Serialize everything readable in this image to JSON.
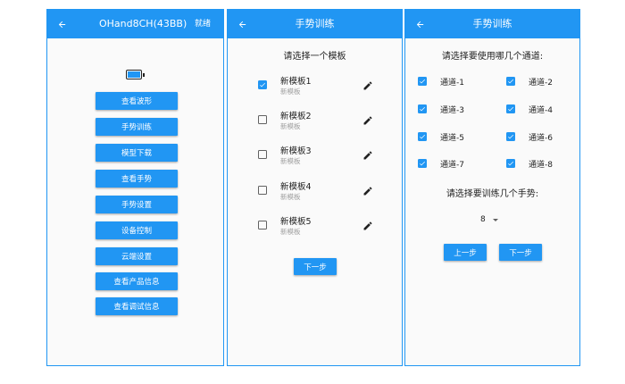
{
  "screen1": {
    "title": "OHand8CH(43BB)",
    "status": "就绪",
    "buttons": [
      "查看波形",
      "手势训练",
      "模型下载",
      "查看手势",
      "手势设置",
      "设备控制",
      "云端设置",
      "查看产品信息",
      "查看调试信息"
    ]
  },
  "screen2": {
    "title": "手势训练",
    "heading": "请选择一个模板",
    "templates": [
      {
        "name": "新模板1",
        "sub": "新模板",
        "checked": true
      },
      {
        "name": "新模板2",
        "sub": "新模板",
        "checked": false
      },
      {
        "name": "新模板3",
        "sub": "新模板",
        "checked": false
      },
      {
        "name": "新模板4",
        "sub": "新模板",
        "checked": false
      },
      {
        "name": "新模板5",
        "sub": "新模板",
        "checked": false
      }
    ],
    "next_label": "下一步"
  },
  "screen3": {
    "title": "手势训练",
    "channel_heading": "请选择要使用哪几个通道:",
    "channels": [
      {
        "label": "通道-1",
        "checked": true
      },
      {
        "label": "通道-2",
        "checked": true
      },
      {
        "label": "通道-3",
        "checked": true
      },
      {
        "label": "通道-4",
        "checked": true
      },
      {
        "label": "通道-5",
        "checked": true
      },
      {
        "label": "通道-6",
        "checked": true
      },
      {
        "label": "通道-7",
        "checked": true
      },
      {
        "label": "通道-8",
        "checked": true
      }
    ],
    "gesture_heading": "请选择要训练几个手势:",
    "gesture_count": "8",
    "prev_label": "上一步",
    "next_label": "下一步"
  },
  "colors": {
    "primary": "#2196f3",
    "background": "#fafafa"
  },
  "icons": {
    "back": "arrow-back-icon",
    "edit": "pencil-edit-icon",
    "battery": "battery-icon",
    "check": "checkbox-checked-icon",
    "dropdown": "dropdown-caret-icon"
  }
}
